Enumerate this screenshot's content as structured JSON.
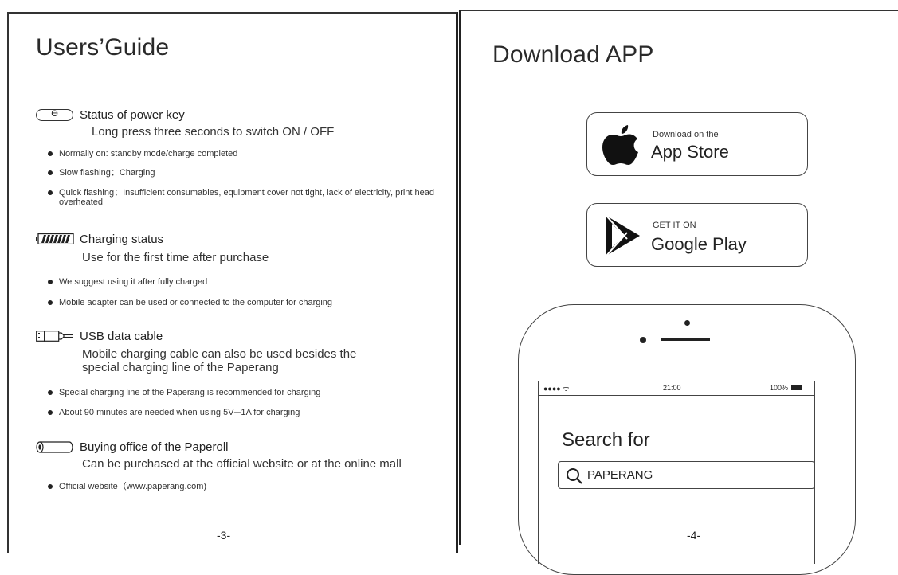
{
  "left_page": {
    "title": "Users’Guide",
    "power": {
      "icon_text": "ϴ",
      "title": "Status of power key",
      "subtitle": "Long press three seconds to switch ON / OFF",
      "bullets": [
        "Normally on: standby mode/charge completed",
        "Slow flashing：Charging",
        "Quick flashing：Insufficient consumables, equipment cover not tight, lack of electricity, print head overheated"
      ]
    },
    "charging": {
      "title": "Charging status",
      "subtitle": "Use for the first time after purchase",
      "bullets": [
        "We suggest using it after fully charged",
        "Mobile adapter can be used or connected to the computer for charging"
      ]
    },
    "usb": {
      "title": "USB data cable",
      "subtitle": "Mobile charging cable can also be used besides the special charging line of the Paperang",
      "bullets": [
        "Special charging line of the Paperang is recommended for charging",
        "About 90 minutes are needed when using 5V⎓1A for charging"
      ]
    },
    "paperoll": {
      "title": "Buying office of the Paperoll",
      "subtitle": "Can be purchased at the official website or at the online mall",
      "bullets": [
        "Official website（www.paperang.com)"
      ]
    },
    "page_number": "-3-"
  },
  "right_page": {
    "title": "Download APP",
    "app_store": {
      "small": "Download on the",
      "big": "App Store",
      "icon": "apple-logo"
    },
    "google_play": {
      "small": "GET IT ON",
      "big": "Google Play",
      "icon": "play-logo"
    },
    "phone": {
      "signal": "●●●● ᯤ",
      "time": "21:00",
      "battery": "100%",
      "search_label": "Search for",
      "search_value": "PAPERANG"
    },
    "page_number": "-4-"
  }
}
